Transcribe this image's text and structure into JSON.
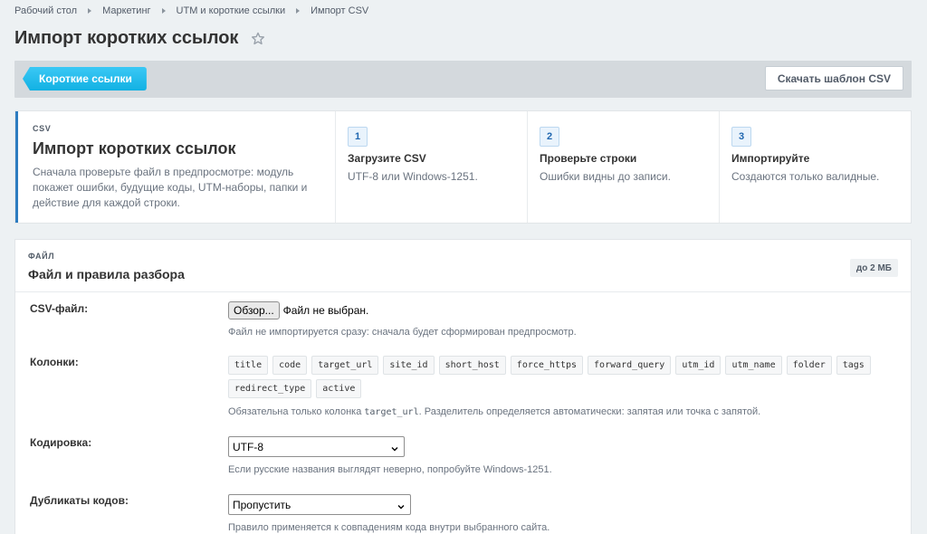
{
  "breadcrumb": [
    "Рабочий стол",
    "Маркетинг",
    "UTM и короткие ссылки",
    "Импорт CSV"
  ],
  "page_title": "Импорт коротких ссылок",
  "toolbar": {
    "back_label": "Короткие ссылки",
    "download_label": "Скачать шаблон CSV"
  },
  "intro": {
    "kicker": "CSV",
    "title": "Импорт коротких ссылок",
    "description": "Сначала проверьте файл в предпросмотре: модуль покажет ошибки, будущие коды, UTM-наборы, папки и действие для каждой строки."
  },
  "steps": [
    {
      "num": "1",
      "title": "Загрузите CSV",
      "desc": "UTF-8 или Windows-1251."
    },
    {
      "num": "2",
      "title": "Проверьте строки",
      "desc": "Ошибки видны до записи."
    },
    {
      "num": "3",
      "title": "Импортируйте",
      "desc": "Создаются только валидные."
    }
  ],
  "form": {
    "kicker": "ФАЙЛ",
    "title": "Файл и правила разбора",
    "size_badge": "до 2 МБ",
    "file": {
      "label": "CSV-файл:",
      "button": "Обзор...",
      "status": "Файл не выбран.",
      "hint": "Файл не импортируется сразу: сначала будет сформирован предпросмотр."
    },
    "columns": {
      "label": "Колонки:",
      "chips": [
        "title",
        "code",
        "target_url",
        "site_id",
        "short_host",
        "force_https",
        "forward_query",
        "utm_id",
        "utm_name",
        "folder",
        "tags",
        "redirect_type",
        "active"
      ],
      "hint_before": "Обязательна только колонка ",
      "hint_code": "target_url",
      "hint_after": ". Разделитель определяется автоматически: запятая или точка с запятой."
    },
    "encoding": {
      "label": "Кодировка:",
      "value": "UTF-8",
      "hint": "Если русские названия выглядят неверно, попробуйте Windows-1251."
    },
    "duplicates": {
      "label": "Дубликаты кодов:",
      "value": "Пропустить",
      "hint": "Правило применяется к совпадениям кода внутри выбранного сайта."
    }
  }
}
